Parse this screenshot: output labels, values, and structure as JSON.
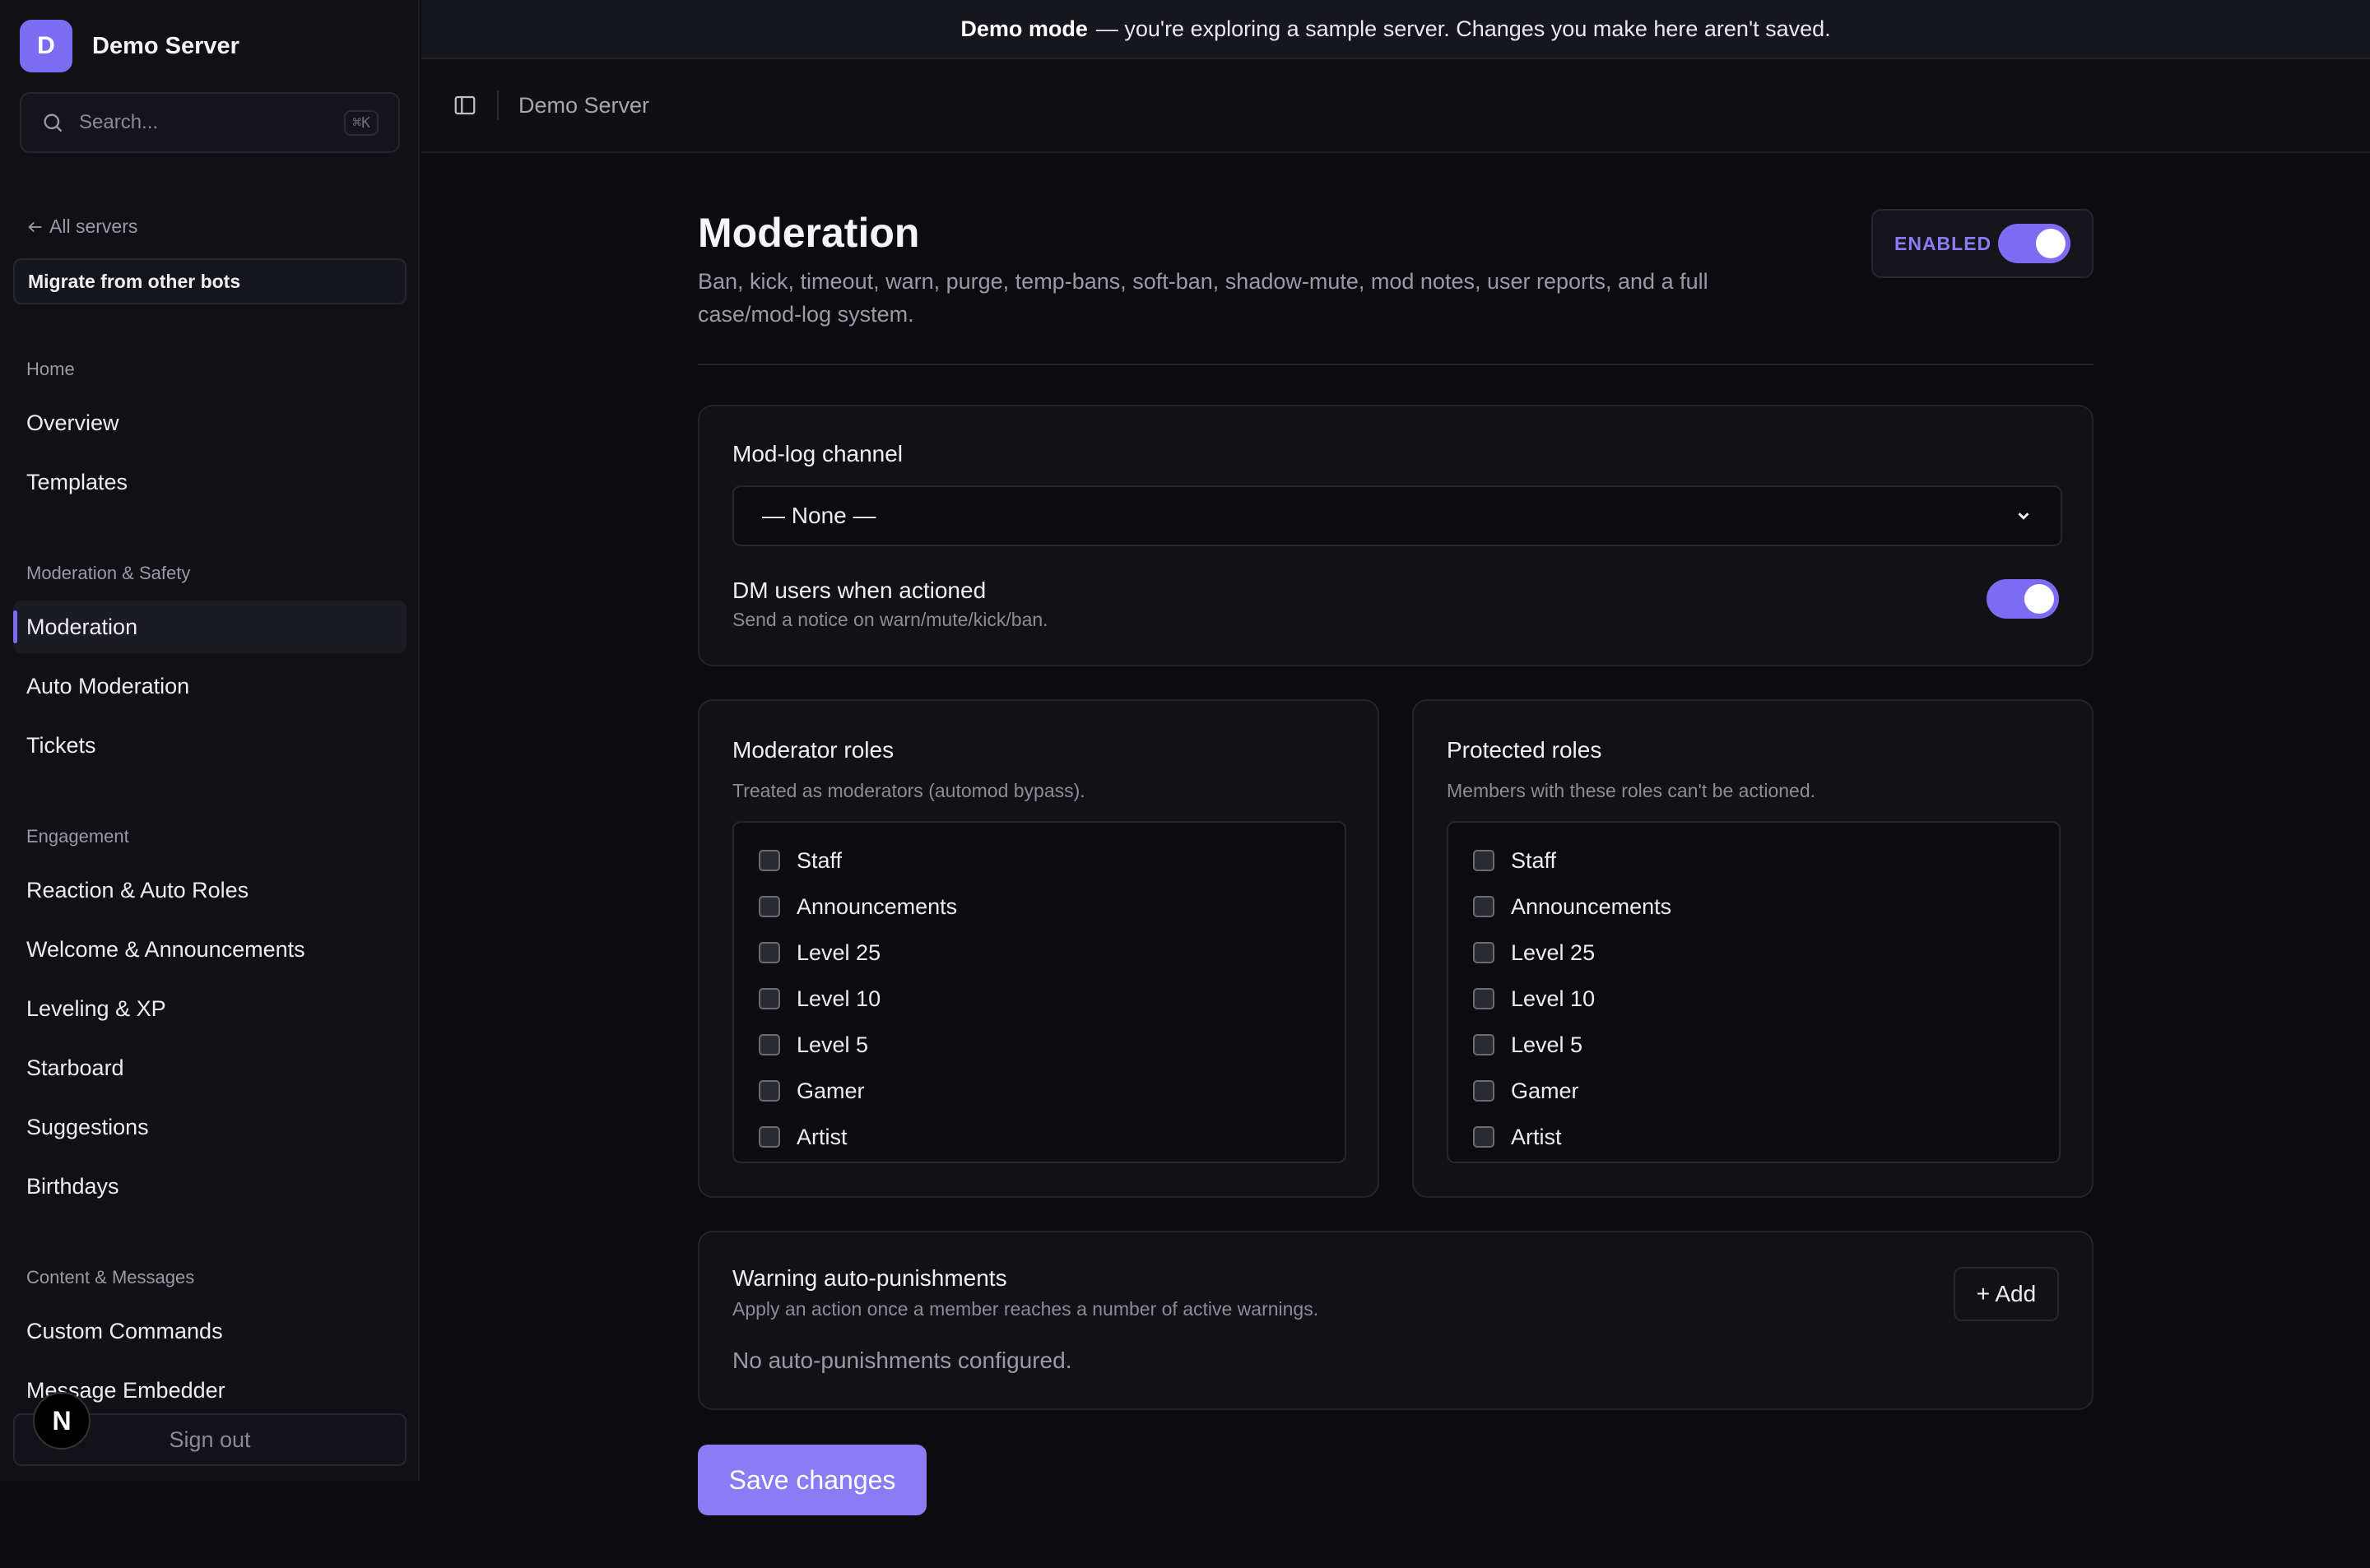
{
  "sidebar": {
    "logo_letter": "D",
    "server_name": "Demo Server",
    "search_placeholder": "Search...",
    "search_shortcut": "⌘K",
    "back_label": "All servers",
    "migrate_label": "Migrate from other bots",
    "groups": {
      "home": "Home",
      "moderation": "Moderation & Safety",
      "engagement": "Engagement",
      "content": "Content & Messages"
    },
    "items": {
      "overview": "Overview",
      "templates": "Templates",
      "moderation": "Moderation",
      "auto_moderation": "Auto Moderation",
      "tickets": "Tickets",
      "reaction_roles": "Reaction & Auto Roles",
      "welcome": "Welcome & Announcements",
      "leveling": "Leveling & XP",
      "starboard": "Starboard",
      "suggestions": "Suggestions",
      "birthdays": "Birthdays",
      "custom_commands": "Custom Commands",
      "message_embedder": "Message Embedder"
    },
    "sign_out": "Sign out",
    "badge_letter": "N"
  },
  "banner": {
    "bold": "Demo mode",
    "text": "— you're exploring a sample server. Changes you make here aren't saved."
  },
  "topbar": {
    "breadcrumb": "Demo Server"
  },
  "page": {
    "title": "Moderation",
    "description": "Ban, kick, timeout, warn, purge, temp-bans, soft-ban, shadow-mute, mod notes, user reports, and a full case/mod-log system.",
    "enabled_label": "ENABLED"
  },
  "modlog": {
    "title": "Mod-log channel",
    "selected": "— None —",
    "dm_title": "DM users when actioned",
    "dm_sub": "Send a notice on warn/mute/kick/ban."
  },
  "moderator_roles": {
    "title": "Moderator roles",
    "sub": "Treated as moderators (automod bypass).",
    "roles": [
      "Staff",
      "Announcements",
      "Level 25",
      "Level 10",
      "Level 5",
      "Gamer",
      "Artist"
    ]
  },
  "protected_roles": {
    "title": "Protected roles",
    "sub": "Members with these roles can't be actioned.",
    "roles": [
      "Staff",
      "Announcements",
      "Level 25",
      "Level 10",
      "Level 5",
      "Gamer",
      "Artist"
    ]
  },
  "punishments": {
    "title": "Warning auto-punishments",
    "sub": "Apply an action once a member reaches a number of active warnings.",
    "add_label": "+ Add",
    "empty": "No auto-punishments configured."
  },
  "save_label": "Save changes",
  "colors": {
    "accent": "#7c6cf2",
    "background": "#0c0c10",
    "sidebar": "#101015"
  }
}
